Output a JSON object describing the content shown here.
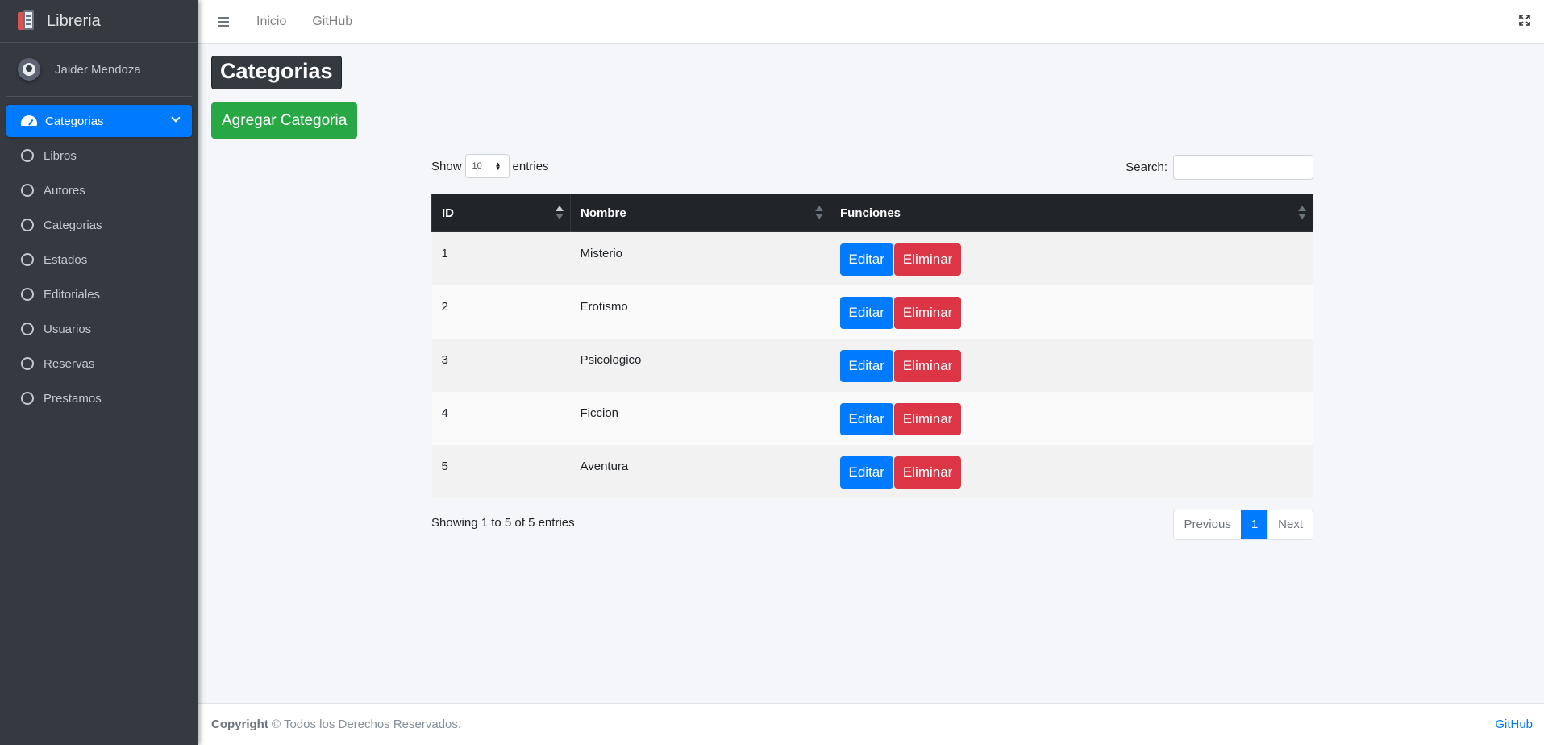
{
  "brand": {
    "name": "Libreria"
  },
  "user": {
    "name": "Jaider Mendoza"
  },
  "sidebar": {
    "active": {
      "label": "Categorias"
    },
    "items": [
      {
        "label": "Libros"
      },
      {
        "label": "Autores"
      },
      {
        "label": "Categorias"
      },
      {
        "label": "Estados"
      },
      {
        "label": "Editoriales"
      },
      {
        "label": "Usuarios"
      },
      {
        "label": "Reservas"
      },
      {
        "label": "Prestamos"
      }
    ]
  },
  "topbar": {
    "links": [
      "Inicio",
      "GitHub"
    ]
  },
  "page": {
    "title": "Categorias",
    "add_button": "Agregar Categoria"
  },
  "table_controls": {
    "show_label": "Show",
    "entries_value": "10",
    "entries_label": "entries",
    "search_label": "Search:"
  },
  "table": {
    "headers": [
      "ID",
      "Nombre",
      "Funciones"
    ],
    "rows": [
      {
        "id": "1",
        "nombre": "Misterio"
      },
      {
        "id": "2",
        "nombre": "Erotismo"
      },
      {
        "id": "3",
        "nombre": "Psicologico"
      },
      {
        "id": "4",
        "nombre": "Ficcion"
      },
      {
        "id": "5",
        "nombre": "Aventura"
      }
    ],
    "edit_label": "Editar",
    "delete_label": "Eliminar"
  },
  "pagination": {
    "info": "Showing 1 to 5 of 5 entries",
    "previous": "Previous",
    "current": "1",
    "next": "Next"
  },
  "footer": {
    "copyright_bold": "Copyright",
    "copyright_rest": " © Todos los Derechos Reservados.",
    "right_link": "GitHub"
  },
  "colors": {
    "sidebar_bg": "#343a40",
    "primary": "#007bff",
    "success": "#28a745",
    "danger": "#dc3545",
    "table_header": "#212529"
  }
}
